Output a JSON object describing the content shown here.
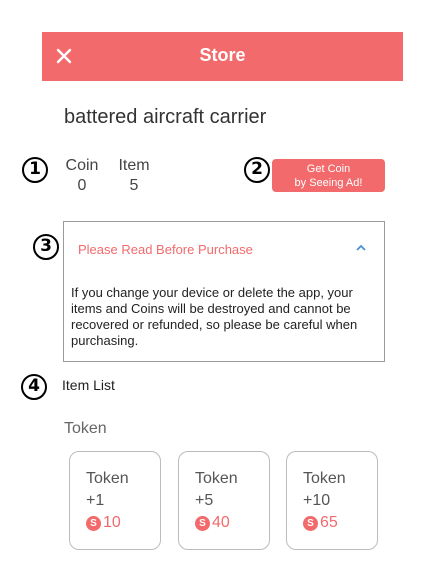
{
  "colors": {
    "accent": "#f26a6c",
    "text": "#333333",
    "border": "#9a9a9a"
  },
  "header": {
    "title": "Store",
    "close_icon": "close-icon"
  },
  "station": {
    "name": "battered aircraft carrier"
  },
  "markers": [
    "1",
    "2",
    "3",
    "4"
  ],
  "stats": {
    "coin_label": "Coin",
    "coin_value": "0",
    "item_label": "Item",
    "item_value": "5"
  },
  "ad_button": {
    "line1": "Get Coin",
    "line2": "by Seeing Ad!"
  },
  "notice": {
    "title": "Please Read Before Purchase",
    "expanded": true,
    "body": "If you change your device or delete the app, your items and Coins will be destroyed and cannot be recovered or refunded, so please be careful when purchasing."
  },
  "item_list": {
    "label": "Item List",
    "group": "Token",
    "products": [
      {
        "name": "Token",
        "qty": "+1",
        "currency_icon": "S",
        "price": "10"
      },
      {
        "name": "Token",
        "qty": "+5",
        "currency_icon": "S",
        "price": "40"
      },
      {
        "name": "Token",
        "qty": "+10",
        "currency_icon": "S",
        "price": "65"
      }
    ]
  }
}
